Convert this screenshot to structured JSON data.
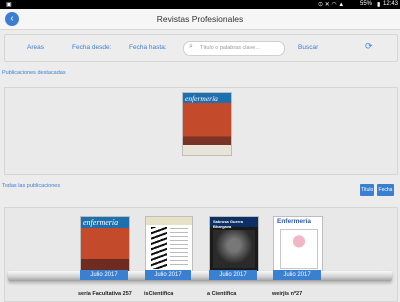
{
  "status": {
    "time": "12:43",
    "battery": "55%",
    "icons": [
      "nfc-icon",
      "mute-icon",
      "wifi-icon",
      "signal-icon",
      "battery-icon"
    ]
  },
  "appbar": {
    "title": "Revistas Profesionales",
    "back_icon": "back-arrow-icon"
  },
  "filters": {
    "areas": "Areas",
    "fecha_desde": "Fecha desde:",
    "fecha_hasta": "Fecha hasta:",
    "search_placeholder": "Título o palabras clave...",
    "buscar": "Buscar",
    "refresh_icon": "refresh-icon"
  },
  "featured": {
    "label": "Publicaciones destacadas",
    "cover_title": "enfermería"
  },
  "all": {
    "label": "Todas las publicaciones",
    "sort_title": "Título",
    "sort_date": "Fecha",
    "items": [
      {
        "cover": "enfermería",
        "date": "Julio 2017",
        "title": "sería Facultativa 257"
      },
      {
        "cover": "",
        "date": "Julio 2017",
        "title": "isCientífica"
      },
      {
        "cover": "Sabrosa Guerra Bhargava",
        "date": "Julio 2017",
        "title": "a Científica"
      },
      {
        "cover": "Enfermería",
        "date": "Julio 2017",
        "title": "weirjis nº27"
      }
    ]
  },
  "colors": {
    "accent": "#3a7fd0",
    "status_bar": "#000000"
  }
}
